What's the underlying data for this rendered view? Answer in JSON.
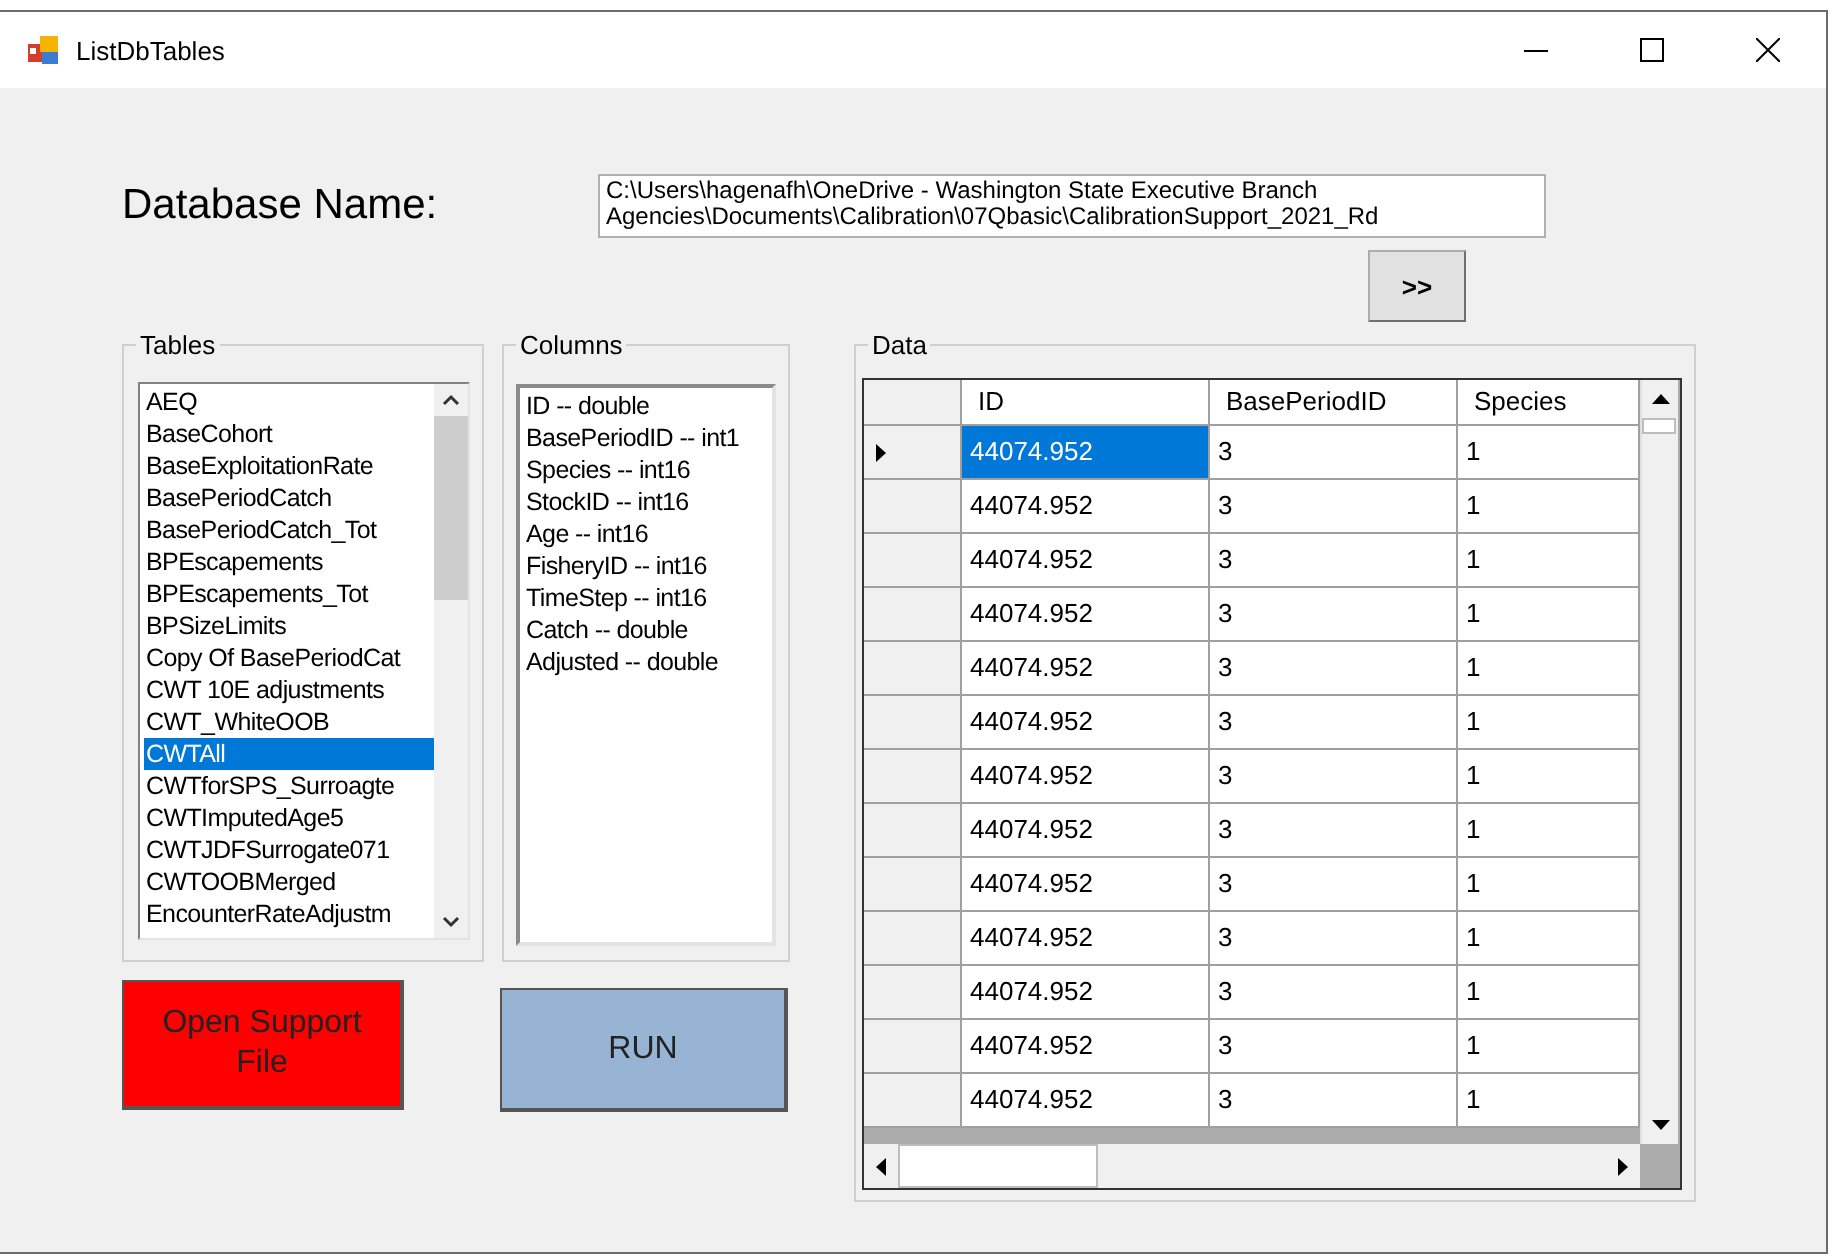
{
  "window": {
    "title": "ListDbTables"
  },
  "database": {
    "label": "Database Name:",
    "path": "C:\\Users\\hagenafh\\OneDrive - Washington State Executive Branch Agencies\\Documents\\Calibration\\07Qbasic\\CalibrationSupport_2021_Rd"
  },
  "browse_button": {
    "label": ">>"
  },
  "tables": {
    "label": "Tables",
    "items": [
      {
        "label": "AEQ",
        "selected": false
      },
      {
        "label": "BaseCohort",
        "selected": false
      },
      {
        "label": "BaseExploitationRate",
        "selected": false
      },
      {
        "label": "BasePeriodCatch",
        "selected": false
      },
      {
        "label": "BasePeriodCatch_Tot",
        "selected": false
      },
      {
        "label": "BPEscapements",
        "selected": false
      },
      {
        "label": "BPEscapements_Tot",
        "selected": false
      },
      {
        "label": "BPSizeLimits",
        "selected": false
      },
      {
        "label": "Copy Of BasePeriodCat",
        "selected": false
      },
      {
        "label": "CWT 10E adjustments",
        "selected": false
      },
      {
        "label": "CWT_WhiteOOB",
        "selected": false
      },
      {
        "label": "CWTAll",
        "selected": true
      },
      {
        "label": "CWTforSPS_Surroagte",
        "selected": false
      },
      {
        "label": "CWTImputedAge5",
        "selected": false
      },
      {
        "label": "CWTJDFSurrogate071",
        "selected": false
      },
      {
        "label": "CWTOOBMerged",
        "selected": false
      },
      {
        "label": "EncounterRateAdjustm",
        "selected": false
      }
    ]
  },
  "columns": {
    "label": "Columns",
    "items": [
      "ID -- double",
      "BasePeriodID -- int1",
      "Species -- int16",
      "StockID -- int16",
      "Age -- int16",
      "FisheryID -- int16",
      "TimeStep -- int16",
      "Catch -- double",
      "Adjusted -- double"
    ]
  },
  "data": {
    "label": "Data",
    "columns": [
      "ID",
      "BasePeriodID",
      "Species"
    ],
    "rows": [
      {
        "current": true,
        "cells": [
          {
            "text": "44074.952",
            "selected": true
          },
          {
            "text": "3",
            "selected": false
          },
          {
            "text": "1",
            "selected": false
          }
        ]
      },
      {
        "current": false,
        "cells": [
          {
            "text": "44074.952",
            "selected": false
          },
          {
            "text": "3",
            "selected": false
          },
          {
            "text": "1",
            "selected": false
          }
        ]
      },
      {
        "current": false,
        "cells": [
          {
            "text": "44074.952",
            "selected": false
          },
          {
            "text": "3",
            "selected": false
          },
          {
            "text": "1",
            "selected": false
          }
        ]
      },
      {
        "current": false,
        "cells": [
          {
            "text": "44074.952",
            "selected": false
          },
          {
            "text": "3",
            "selected": false
          },
          {
            "text": "1",
            "selected": false
          }
        ]
      },
      {
        "current": false,
        "cells": [
          {
            "text": "44074.952",
            "selected": false
          },
          {
            "text": "3",
            "selected": false
          },
          {
            "text": "1",
            "selected": false
          }
        ]
      },
      {
        "current": false,
        "cells": [
          {
            "text": "44074.952",
            "selected": false
          },
          {
            "text": "3",
            "selected": false
          },
          {
            "text": "1",
            "selected": false
          }
        ]
      },
      {
        "current": false,
        "cells": [
          {
            "text": "44074.952",
            "selected": false
          },
          {
            "text": "3",
            "selected": false
          },
          {
            "text": "1",
            "selected": false
          }
        ]
      },
      {
        "current": false,
        "cells": [
          {
            "text": "44074.952",
            "selected": false
          },
          {
            "text": "3",
            "selected": false
          },
          {
            "text": "1",
            "selected": false
          }
        ]
      },
      {
        "current": false,
        "cells": [
          {
            "text": "44074.952",
            "selected": false
          },
          {
            "text": "3",
            "selected": false
          },
          {
            "text": "1",
            "selected": false
          }
        ]
      },
      {
        "current": false,
        "cells": [
          {
            "text": "44074.952",
            "selected": false
          },
          {
            "text": "3",
            "selected": false
          },
          {
            "text": "1",
            "selected": false
          }
        ]
      },
      {
        "current": false,
        "cells": [
          {
            "text": "44074.952",
            "selected": false
          },
          {
            "text": "3",
            "selected": false
          },
          {
            "text": "1",
            "selected": false
          }
        ]
      },
      {
        "current": false,
        "cells": [
          {
            "text": "44074.952",
            "selected": false
          },
          {
            "text": "3",
            "selected": false
          },
          {
            "text": "1",
            "selected": false
          }
        ]
      },
      {
        "current": false,
        "cells": [
          {
            "text": "44074.952",
            "selected": false
          },
          {
            "text": "3",
            "selected": false
          },
          {
            "text": "1",
            "selected": false
          }
        ]
      }
    ]
  },
  "buttons": [
    {
      "label": "Open Support File",
      "kind": "danger"
    },
    {
      "label": "RUN",
      "kind": "primary"
    }
  ]
}
